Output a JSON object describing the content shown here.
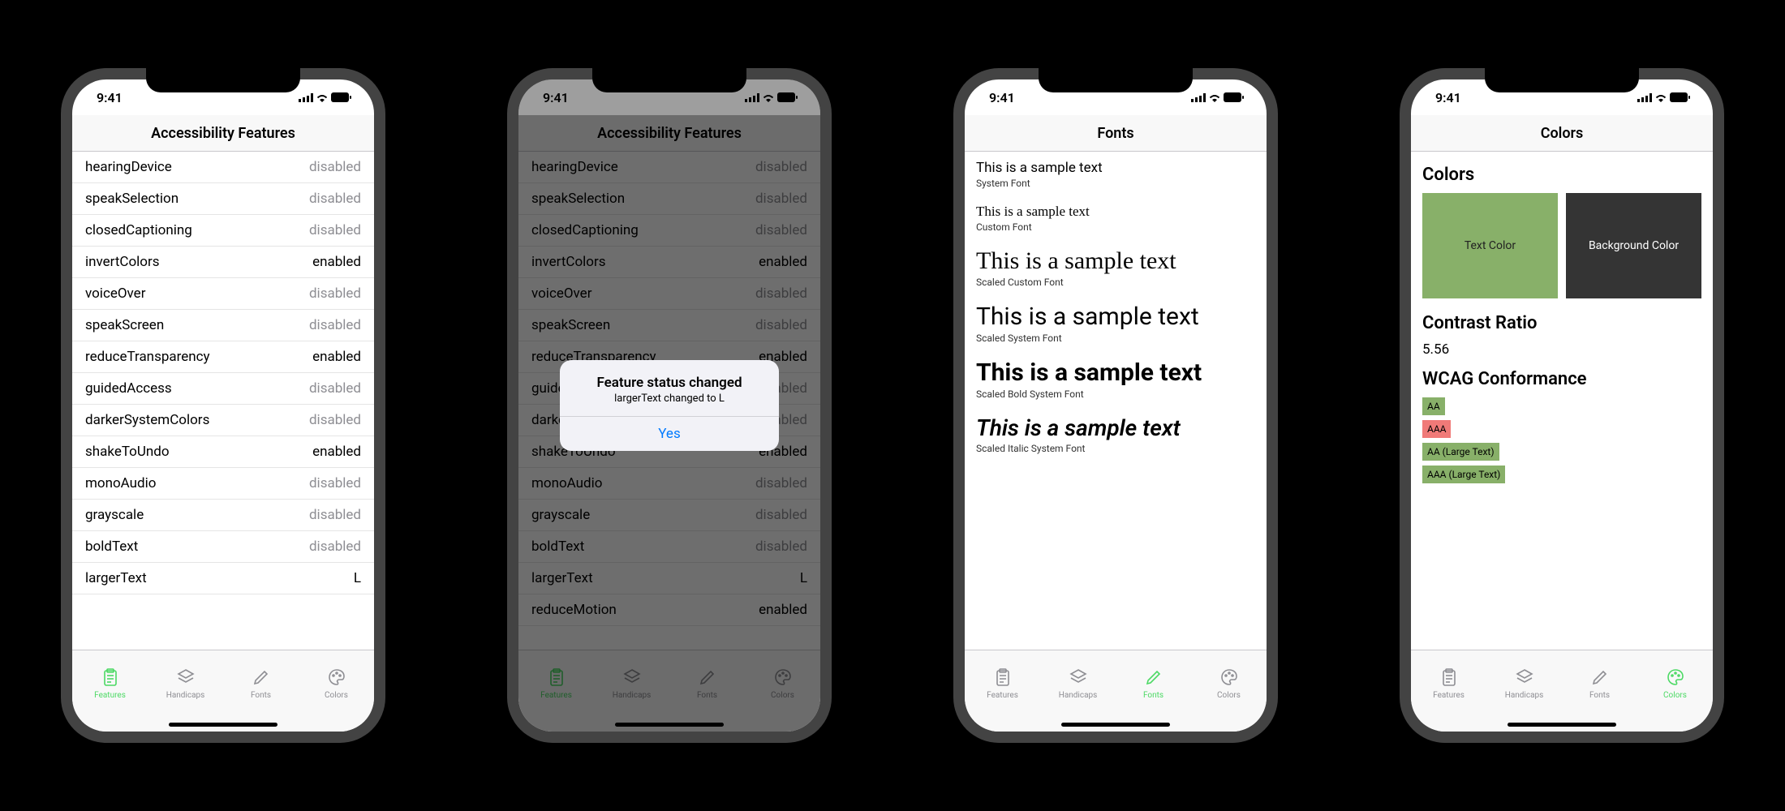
{
  "status_time": "9:41",
  "accent_color": "#4cd964",
  "screen1": {
    "title": "Accessibility Features",
    "features": [
      {
        "name": "hearingDevice",
        "status": "disabled"
      },
      {
        "name": "speakSelection",
        "status": "disabled"
      },
      {
        "name": "closedCaptioning",
        "status": "disabled"
      },
      {
        "name": "invertColors",
        "status": "enabled"
      },
      {
        "name": "voiceOver",
        "status": "disabled"
      },
      {
        "name": "speakScreen",
        "status": "disabled"
      },
      {
        "name": "reduceTransparency",
        "status": "enabled"
      },
      {
        "name": "guidedAccess",
        "status": "disabled"
      },
      {
        "name": "darkerSystemColors",
        "status": "disabled"
      },
      {
        "name": "shakeToUndo",
        "status": "enabled"
      },
      {
        "name": "monoAudio",
        "status": "disabled"
      },
      {
        "name": "grayscale",
        "status": "disabled"
      },
      {
        "name": "boldText",
        "status": "disabled"
      },
      {
        "name": "largerText",
        "status": "L"
      }
    ],
    "active_tab": "Features"
  },
  "screen2": {
    "title": "Accessibility Features",
    "features": [
      {
        "name": "hearingDevice",
        "status": "disabled"
      },
      {
        "name": "speakSelection",
        "status": "disabled"
      },
      {
        "name": "closedCaptioning",
        "status": "disabled"
      },
      {
        "name": "invertColors",
        "status": "enabled"
      },
      {
        "name": "voiceOver",
        "status": "disabled"
      },
      {
        "name": "speakScreen",
        "status": "disabled"
      },
      {
        "name": "reduceTransparency",
        "status": "enabled"
      },
      {
        "name": "guidedAccess",
        "status": "disabled"
      },
      {
        "name": "darkerSystemColors",
        "status": "disabled"
      },
      {
        "name": "shakeToUndo",
        "status": "enabled"
      },
      {
        "name": "monoAudio",
        "status": "disabled"
      },
      {
        "name": "grayscale",
        "status": "disabled"
      },
      {
        "name": "boldText",
        "status": "disabled"
      },
      {
        "name": "largerText",
        "status": "L"
      },
      {
        "name": "reduceMotion",
        "status": "enabled"
      }
    ],
    "alert": {
      "title": "Feature status changed",
      "message": "largerText changed to L",
      "button": "Yes"
    },
    "active_tab": "Features"
  },
  "screen3": {
    "title": "Fonts",
    "samples": [
      {
        "text": "This is a sample text",
        "caption": "System Font",
        "cls": "s1"
      },
      {
        "text": "This is a sample text",
        "caption": "Custom Font",
        "cls": "s2"
      },
      {
        "text": "This is a sample text",
        "caption": "Scaled Custom Font",
        "cls": "s3"
      },
      {
        "text": "This is a sample text",
        "caption": "Scaled System Font",
        "cls": "s4"
      },
      {
        "text": "This is a sample text",
        "caption": "Scaled Bold System Font",
        "cls": "s5"
      },
      {
        "text": "This is a sample text",
        "caption": "Scaled Italic System Font",
        "cls": "s6"
      }
    ],
    "active_tab": "Fonts"
  },
  "screen4": {
    "title": "Colors",
    "section_title": "Colors",
    "swatch_text_label": "Text Color",
    "swatch_bg_label": "Background Color",
    "contrast_heading": "Contrast Ratio",
    "contrast_value": "5.56",
    "wcag_heading": "WCAG Conformance",
    "badges": [
      {
        "label": "AA",
        "pass": true
      },
      {
        "label": "AAA",
        "pass": false
      },
      {
        "label": "AA (Large Text)",
        "pass": true
      },
      {
        "label": "AAA (Large Text)",
        "pass": true
      }
    ],
    "active_tab": "Colors"
  },
  "tabs": [
    {
      "id": "Features",
      "label": "Features",
      "icon": "clipboard-icon"
    },
    {
      "id": "Handicaps",
      "label": "Handicaps",
      "icon": "layers-icon"
    },
    {
      "id": "Fonts",
      "label": "Fonts",
      "icon": "pen-icon"
    },
    {
      "id": "Colors",
      "label": "Colors",
      "icon": "palette-icon"
    }
  ]
}
